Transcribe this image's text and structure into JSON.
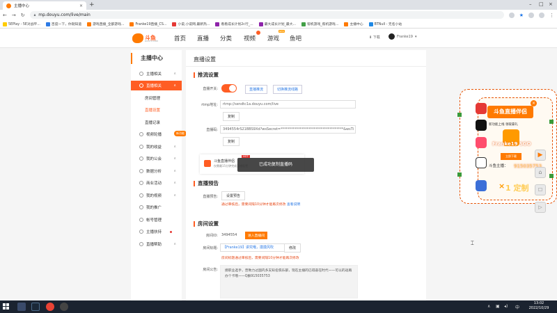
{
  "browser": {
    "tab_title": "主播中心",
    "url": "mp.douyu.com/live/main",
    "bookmarks": [
      "5EPlay - 5E对战平...",
      "百度一下，你就知道",
      "游戏直播_全部游戏...",
      "Franke19直播_CS...",
      "小说,小说网,最新热...",
      "看看成长计划2c行_...",
      "最大成长计划_最大...",
      "帮机游戏_帮机游戏...",
      "主播中心",
      "BTNull - 无名小站"
    ]
  },
  "header": {
    "logo_text": "斗鱼",
    "logo_sub": "DOUYU.COM",
    "nav": [
      "首页",
      "直播",
      "分类",
      "视频",
      "游戏",
      "鱼吧"
    ],
    "new_badge": "NEW",
    "download": "下载",
    "username": "Franke19"
  },
  "sidebar": {
    "title": "主播中心",
    "items": [
      {
        "label": "主播相关",
        "active": false,
        "sub": false
      },
      {
        "label": "直播相关",
        "active": true,
        "sub": false
      },
      {
        "label": "房间管理",
        "active": false,
        "sub": true
      },
      {
        "label": "直播设置",
        "active": true,
        "sub": true
      },
      {
        "label": "直播记录",
        "active": false,
        "sub": true
      },
      {
        "label": "视频轮播",
        "active": false,
        "sub": false
      },
      {
        "label": "我的收益",
        "active": false,
        "sub": false
      },
      {
        "label": "我的公会",
        "active": false,
        "sub": false
      },
      {
        "label": "数据分析",
        "active": false,
        "sub": false
      },
      {
        "label": "商业活动",
        "active": false,
        "sub": false
      },
      {
        "label": "我的视频",
        "active": false,
        "sub": false
      },
      {
        "label": "我的推广",
        "active": false,
        "sub": false
      },
      {
        "label": "帐号管理",
        "active": false,
        "sub": false
      },
      {
        "label": "主播扶持",
        "active": false,
        "sub": false
      },
      {
        "label": "直播帮助",
        "active": false,
        "sub": false
      }
    ],
    "new_tag": "新功能"
  },
  "main": {
    "page_title": "直播设置",
    "stream": {
      "section": "推流设置",
      "switch_label": "直播开关:",
      "live_links_btn": "直播推流",
      "backup_btn": "切换推流线路",
      "rtmp_label": "rtmp地址:",
      "rtmp_value": "rtmp://sendtc1a.douyu.com/live",
      "copy": "复制",
      "code_label": "直播码:",
      "code_value": "3494554rS21BBS9Xd?wsSecret=************************************&wsTi",
      "promo_title": "斗鱼直播伴侣",
      "promo_sub": "仅需最15分钟完成直播配置",
      "promo_hot": "HOT"
    },
    "toast": "已成功复制直播码",
    "preview": {
      "section": "直播预告",
      "label": "直播预告:",
      "button": "设置预告",
      "warn": "通过审核后，需要间隔10分钟才能再次修改",
      "warn_link": "查看说明"
    },
    "room": {
      "section": "房间设置",
      "id_label": "房间ID:",
      "id_value": "3494554",
      "apply_btn": "进入直播间",
      "name_label": "房间标题:",
      "name_value": "【Franke19】讲究哦，摸摸风吹",
      "edit_btn": "修改",
      "name_warn": "房间标题通过审核后，需要间隔10分钟才能再次修改",
      "notice_label": "房间公告:",
      "notice_text": "摸职业选手，曾致力过国内多支知名俱乐部，现在主播的已得奋在时代一一可以的返再办个卡哦一一Q群915035753"
    }
  },
  "ad": {
    "head": "斗鱼直播伴侣",
    "sub": "新功能上线 领取豪礼",
    "rank": "Franke19 SGO",
    "fans": "斗鱼主播：",
    "num": "915035753",
    "button": "立即下载",
    "x1": "×",
    "one": "1 定制"
  },
  "taskbar": {
    "time": "13:02",
    "date": "2022/10/29"
  },
  "colors": {
    "accent": "#ff5d23",
    "link": "#2d7be5",
    "warn": "#e64a19",
    "sidebar_active": "#ff5d23"
  }
}
